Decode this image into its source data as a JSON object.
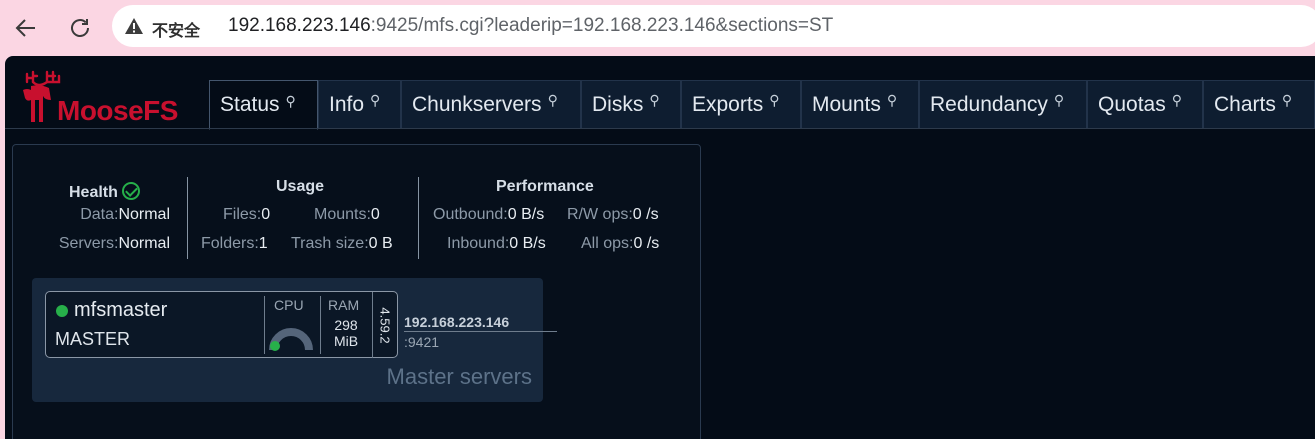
{
  "browser": {
    "security_label": "不安全",
    "url_host": "192.168.223.146",
    "url_rest": ":9425/mfs.cgi?leaderip=192.168.223.146&sections=ST"
  },
  "app": {
    "logo_text": "MooseFS",
    "tabs": [
      {
        "label": "Status"
      },
      {
        "label": "Info"
      },
      {
        "label": "Chunkservers"
      },
      {
        "label": "Disks"
      },
      {
        "label": "Exports"
      },
      {
        "label": "Mounts"
      },
      {
        "label": "Redundancy"
      },
      {
        "label": "Quotas"
      },
      {
        "label": "Charts"
      }
    ],
    "active_tab": "Status"
  },
  "health": {
    "title": "Health",
    "data_label": "Data:",
    "data_value": "Normal",
    "servers_label": "Servers:",
    "servers_value": "Normal"
  },
  "usage": {
    "title": "Usage",
    "files_label": "Files:",
    "files_value": "0",
    "mounts_label": "Mounts:",
    "mounts_value": "0",
    "folders_label": "Folders:",
    "folders_value": "1",
    "trash_label": "Trash size:",
    "trash_value": "0 B"
  },
  "performance": {
    "title": "Performance",
    "outbound_label": "Outbound:",
    "outbound_value": "0 B/s",
    "rw_label": "R/W ops:",
    "rw_value": "0 /s",
    "inbound_label": "Inbound:",
    "inbound_value": "0 B/s",
    "all_label": "All ops:",
    "all_value": "0 /s"
  },
  "masters": {
    "title": "Master servers",
    "server": {
      "name": "mfsmaster",
      "role": "MASTER",
      "cpu_label": "CPU",
      "ram_label": "RAM",
      "ram_value": "298",
      "ram_unit": "MiB",
      "version": "4.59.2",
      "ip": "192.168.223.146",
      "port": ":9421",
      "status_color": "#27b04a"
    }
  }
}
